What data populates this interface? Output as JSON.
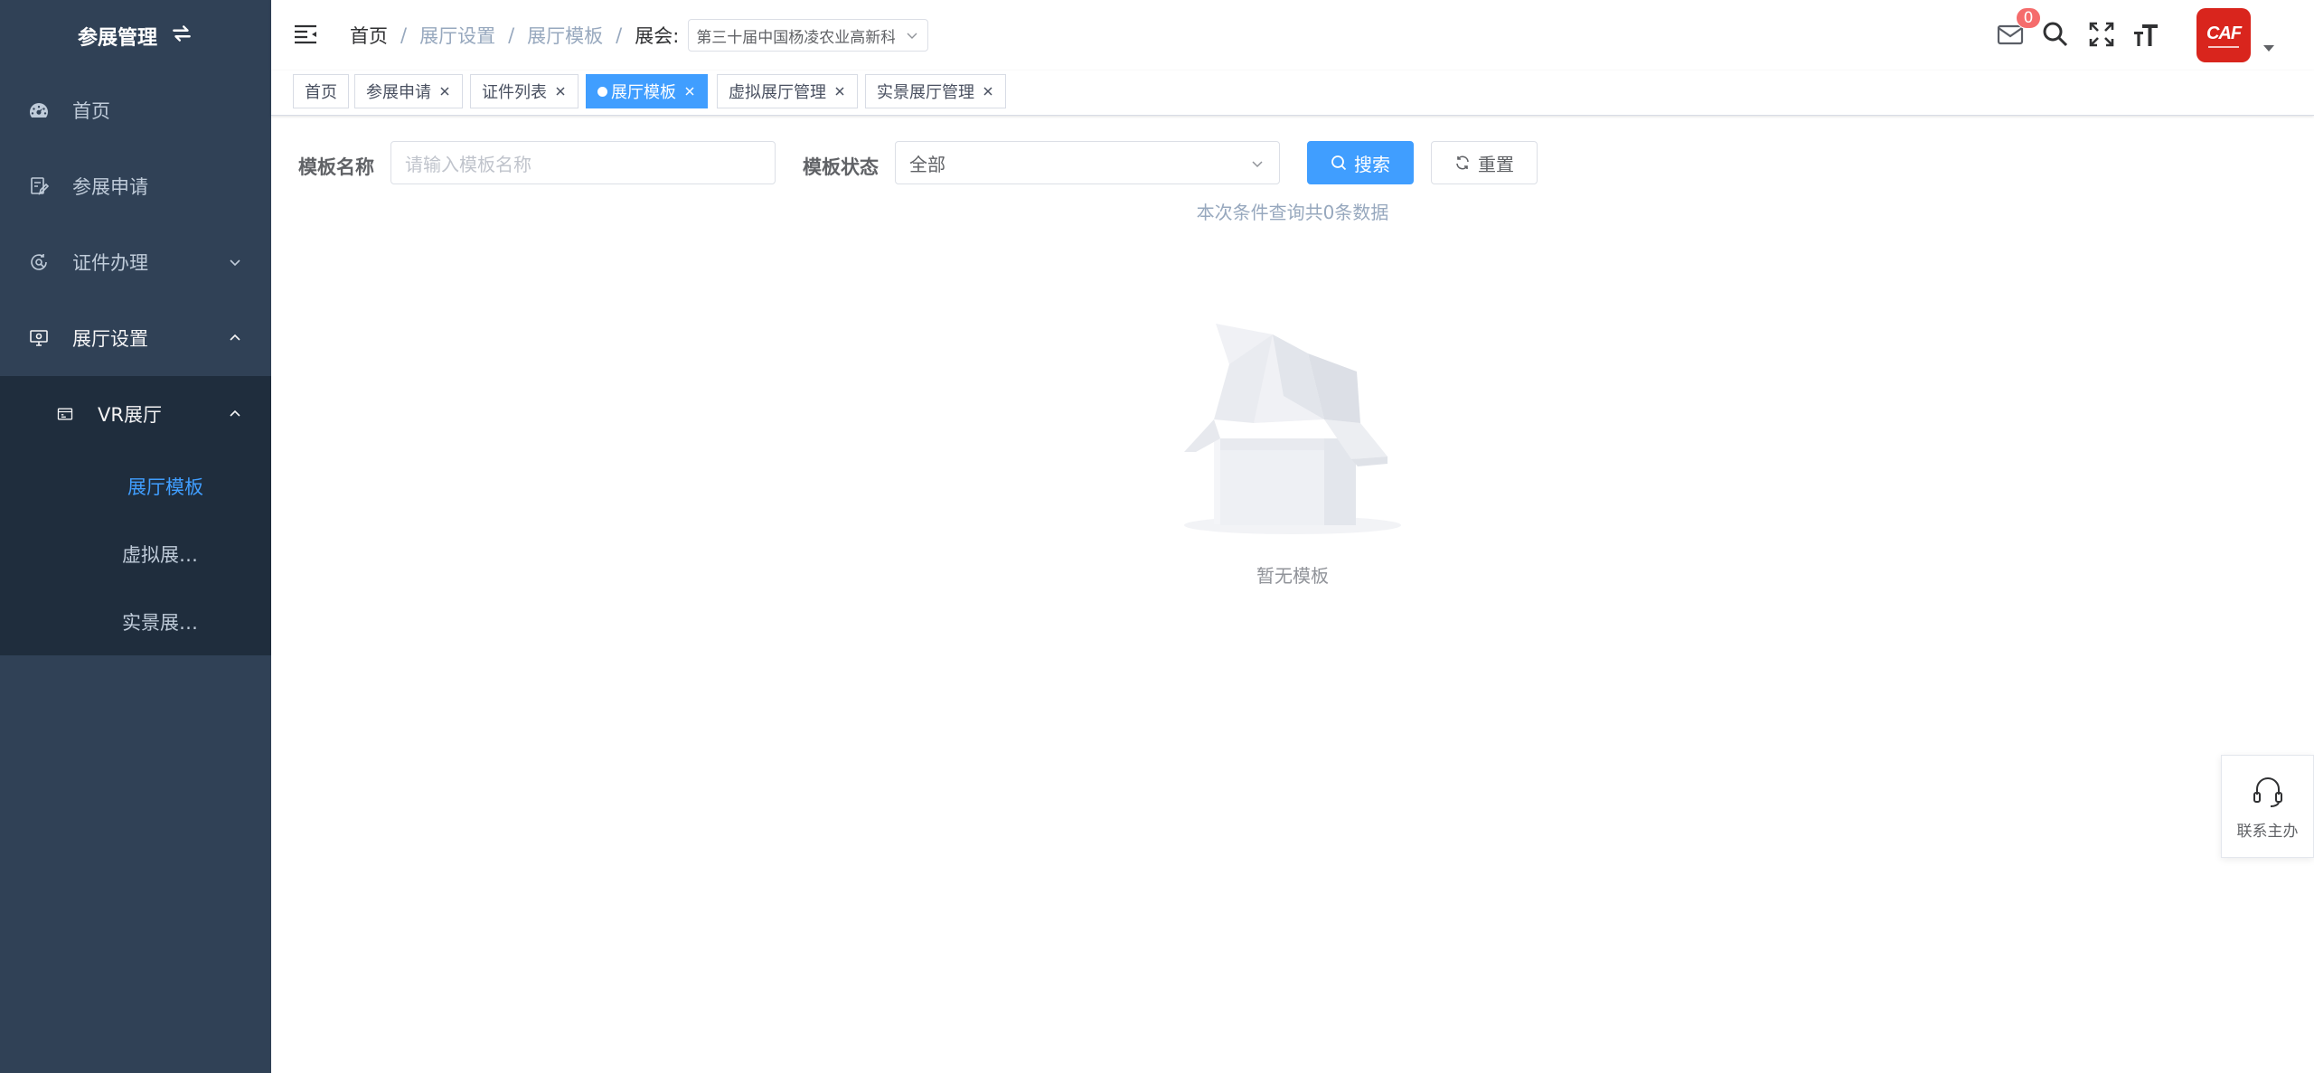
{
  "sidebar": {
    "title": "参展管理",
    "items": [
      {
        "label": "首页",
        "icon": "dashboard-icon"
      },
      {
        "label": "参展申请",
        "icon": "form-icon"
      },
      {
        "label": "证件办理",
        "icon": "certificate-icon"
      },
      {
        "label": "展厅设置",
        "icon": "monitor-icon"
      }
    ],
    "submenu": {
      "label": "VR展厅",
      "icon": "vr-icon",
      "children": [
        {
          "label": "展厅模板",
          "active": true
        },
        {
          "label": "虚拟展…",
          "active": false
        },
        {
          "label": "实景展…",
          "active": false
        }
      ]
    }
  },
  "navbar": {
    "breadcrumb": [
      "首页",
      "展厅设置",
      "展厅模板"
    ],
    "separator": "/",
    "expo_label": "展会:",
    "expo_value": "第三十届中国杨凌农业高新科技成果博览会",
    "message_count": "0",
    "avatar_text": "CAF"
  },
  "tags": [
    {
      "label": "首页",
      "closable": false,
      "active": false
    },
    {
      "label": "参展申请",
      "closable": true,
      "active": false
    },
    {
      "label": "证件列表",
      "closable": true,
      "active": false
    },
    {
      "label": "展厅模板",
      "closable": true,
      "active": true
    },
    {
      "label": "虚拟展厅管理",
      "closable": true,
      "active": false
    },
    {
      "label": "实景展厅管理",
      "closable": true,
      "active": false
    }
  ],
  "search": {
    "name_label": "模板名称",
    "name_placeholder": "请输入模板名称",
    "status_label": "模板状态",
    "status_value": "全部",
    "search_button": "搜索",
    "reset_button": "重置",
    "result_text": "本次条件查询共0条数据"
  },
  "empty": {
    "text": "暂无模板"
  },
  "contact": {
    "label": "联系主办"
  },
  "colors": {
    "sidebar_bg": "#304156",
    "submenu_bg": "#1f2d3d",
    "primary": "#409eff",
    "badge": "#f56c6c",
    "brand_red": "#d9251d"
  }
}
